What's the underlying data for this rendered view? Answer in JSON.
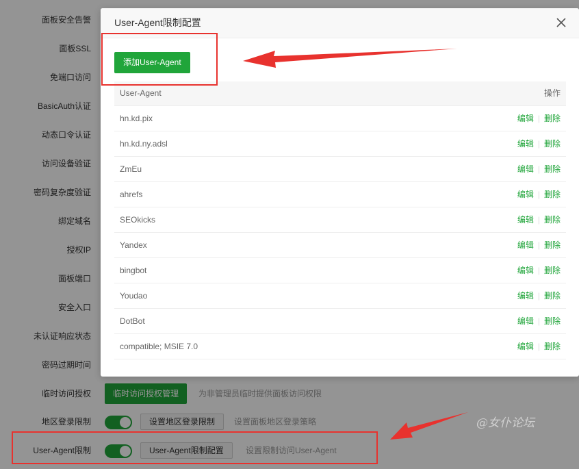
{
  "background": {
    "rows": [
      {
        "label": "面板安全告警"
      },
      {
        "label": "面板SSL"
      },
      {
        "label": "免端口访问"
      },
      {
        "label": "BasicAuth认证"
      },
      {
        "label": "动态口令认证"
      },
      {
        "label": "访问设备验证"
      },
      {
        "label": "密码复杂度验证"
      },
      {
        "label": "绑定域名"
      },
      {
        "label": "授权IP"
      },
      {
        "label": "面板端口"
      },
      {
        "label": "安全入口"
      },
      {
        "label": "未认证响应状态"
      },
      {
        "label": "密码过期时间"
      }
    ],
    "temp_access": {
      "label": "临时访问授权",
      "button": "临时访问授权管理",
      "desc": "为非管理员临时提供面板访问权限"
    },
    "region_login": {
      "label": "地区登录限制",
      "toggle_on": true,
      "button": "设置地区登录限制",
      "desc": "设置面板地区登录策略"
    },
    "ua_limit": {
      "label": "User-Agent限制",
      "toggle_on": true,
      "button": "User-Agent限制配置",
      "desc": "设置限制访问User-Agent"
    }
  },
  "modal": {
    "title": "User-Agent限制配置",
    "add_button": "添加User-Agent",
    "columns": {
      "ua": "User-Agent",
      "op": "操作"
    },
    "rows": [
      {
        "ua": "hn.kd.pix",
        "edit": "编辑",
        "delete": "删除"
      },
      {
        "ua": "hn.kd.ny.adsl",
        "edit": "编辑",
        "delete": "删除"
      },
      {
        "ua": "ZmEu",
        "edit": "编辑",
        "delete": "删除"
      },
      {
        "ua": "ahrefs",
        "edit": "编辑",
        "delete": "删除"
      },
      {
        "ua": "SEOkicks",
        "edit": "编辑",
        "delete": "删除"
      },
      {
        "ua": "Yandex",
        "edit": "编辑",
        "delete": "删除"
      },
      {
        "ua": "bingbot",
        "edit": "编辑",
        "delete": "删除"
      },
      {
        "ua": "Youdao",
        "edit": "编辑",
        "delete": "删除"
      },
      {
        "ua": "DotBot",
        "edit": "编辑",
        "delete": "删除"
      },
      {
        "ua": "compatible; MSIE 7.0",
        "edit": "编辑",
        "delete": "删除"
      }
    ]
  },
  "watermark": "@女仆论坛",
  "colors": {
    "accent": "#20a53a",
    "annotation": "#e8322e"
  }
}
